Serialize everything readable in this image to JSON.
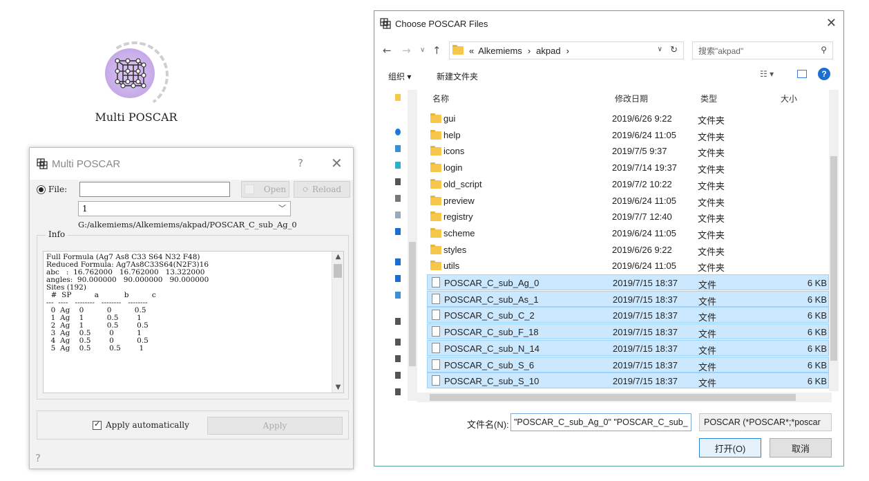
{
  "widget": {
    "label": "Multi POSCAR"
  },
  "poscar_dialog": {
    "title": "Multi POSCAR",
    "help_glyph": "?",
    "close_glyph": "✕",
    "file_label": "File:",
    "file_value": "",
    "open_label": "Open",
    "reload_label": "Reload",
    "combo_value": "1",
    "path": "G:/alkemiems/Alkemiems/akpad/POSCAR_C_sub_Ag_0",
    "info_legend": "Info",
    "info_lines": [
      "Full Formula (Ag7 As8 C33 S64 N32 F48)",
      "Reduced Formula: Ag7As8C33S64(N2F3)16",
      "abc   :  16.762000   16.762000   13.322000",
      "angles:  90.000000   90.000000   90.000000",
      "Sites (192)",
      "  #  SP          a           b          c",
      "---  ----   --------   --------   --------",
      "  0  Ag    0          0          0.5",
      "  1  Ag    1          0.5        1",
      "  2  Ag    1          0.5        0.5",
      "  3  Ag    0.5        0          1",
      "  4  Ag    0.5        0          0.5",
      "  5  Ag    0.5        0.5        1"
    ],
    "apply_auto_label": "Apply automatically",
    "apply_label": "Apply",
    "bottom_help": "?"
  },
  "chooser": {
    "title": "Choose POSCAR Files",
    "close_glyph": "✕",
    "breadcrumb": [
      "«",
      "Alkemiems",
      "›",
      "akpad",
      "›"
    ],
    "search_placeholder": "搜索\"akpad\"",
    "toolbar": {
      "organize": "组织 ▾",
      "new_folder": "新建文件夹"
    },
    "columns": {
      "name": "名称",
      "date": "修改日期",
      "type": "类型",
      "size": "大小"
    },
    "files": [
      {
        "name": "gui",
        "date": "2019/6/26 9:22",
        "type": "文件夹",
        "size": "",
        "kind": "folder",
        "selected": false
      },
      {
        "name": "help",
        "date": "2019/6/24 11:05",
        "type": "文件夹",
        "size": "",
        "kind": "folder",
        "selected": false
      },
      {
        "name": "icons",
        "date": "2019/7/5 9:37",
        "type": "文件夹",
        "size": "",
        "kind": "folder",
        "selected": false
      },
      {
        "name": "login",
        "date": "2019/7/14 19:37",
        "type": "文件夹",
        "size": "",
        "kind": "folder",
        "selected": false
      },
      {
        "name": "old_script",
        "date": "2019/7/2 10:22",
        "type": "文件夹",
        "size": "",
        "kind": "folder",
        "selected": false
      },
      {
        "name": "preview",
        "date": "2019/6/24 11:05",
        "type": "文件夹",
        "size": "",
        "kind": "folder",
        "selected": false
      },
      {
        "name": "registry",
        "date": "2019/7/7 12:40",
        "type": "文件夹",
        "size": "",
        "kind": "folder",
        "selected": false
      },
      {
        "name": "scheme",
        "date": "2019/6/24 11:05",
        "type": "文件夹",
        "size": "",
        "kind": "folder",
        "selected": false
      },
      {
        "name": "styles",
        "date": "2019/6/26 9:22",
        "type": "文件夹",
        "size": "",
        "kind": "folder",
        "selected": false
      },
      {
        "name": "utils",
        "date": "2019/6/24 11:05",
        "type": "文件夹",
        "size": "",
        "kind": "folder",
        "selected": false
      },
      {
        "name": "POSCAR_C_sub_Ag_0",
        "date": "2019/7/15 18:37",
        "type": "文件",
        "size": "6 KB",
        "kind": "file",
        "selected": true
      },
      {
        "name": "POSCAR_C_sub_As_1",
        "date": "2019/7/15 18:37",
        "type": "文件",
        "size": "6 KB",
        "kind": "file",
        "selected": true
      },
      {
        "name": "POSCAR_C_sub_C_2",
        "date": "2019/7/15 18:37",
        "type": "文件",
        "size": "6 KB",
        "kind": "file",
        "selected": true
      },
      {
        "name": "POSCAR_C_sub_F_18",
        "date": "2019/7/15 18:37",
        "type": "文件",
        "size": "6 KB",
        "kind": "file",
        "selected": true
      },
      {
        "name": "POSCAR_C_sub_N_14",
        "date": "2019/7/15 18:37",
        "type": "文件",
        "size": "6 KB",
        "kind": "file",
        "selected": true
      },
      {
        "name": "POSCAR_C_sub_S_6",
        "date": "2019/7/15 18:37",
        "type": "文件",
        "size": "6 KB",
        "kind": "file",
        "selected": true
      },
      {
        "name": "POSCAR_C_sub_S_10",
        "date": "2019/7/15 18:37",
        "type": "文件",
        "size": "6 KB",
        "kind": "file",
        "selected": true
      }
    ],
    "filename_label": "文件名(N):",
    "filename_value": "\"POSCAR_C_sub_Ag_0\" \"POSCAR_C_sub_",
    "filter_value": "POSCAR (*POSCAR*;*poscar",
    "open_label": "打开(O)",
    "cancel_label": "取消"
  },
  "colors": {
    "selection": "#cce8ff",
    "selection_border": "#99d1ff",
    "folder": "#f5c84b",
    "chooser_border": "#5aa7a0",
    "widget_circle": "#c9aee9"
  }
}
